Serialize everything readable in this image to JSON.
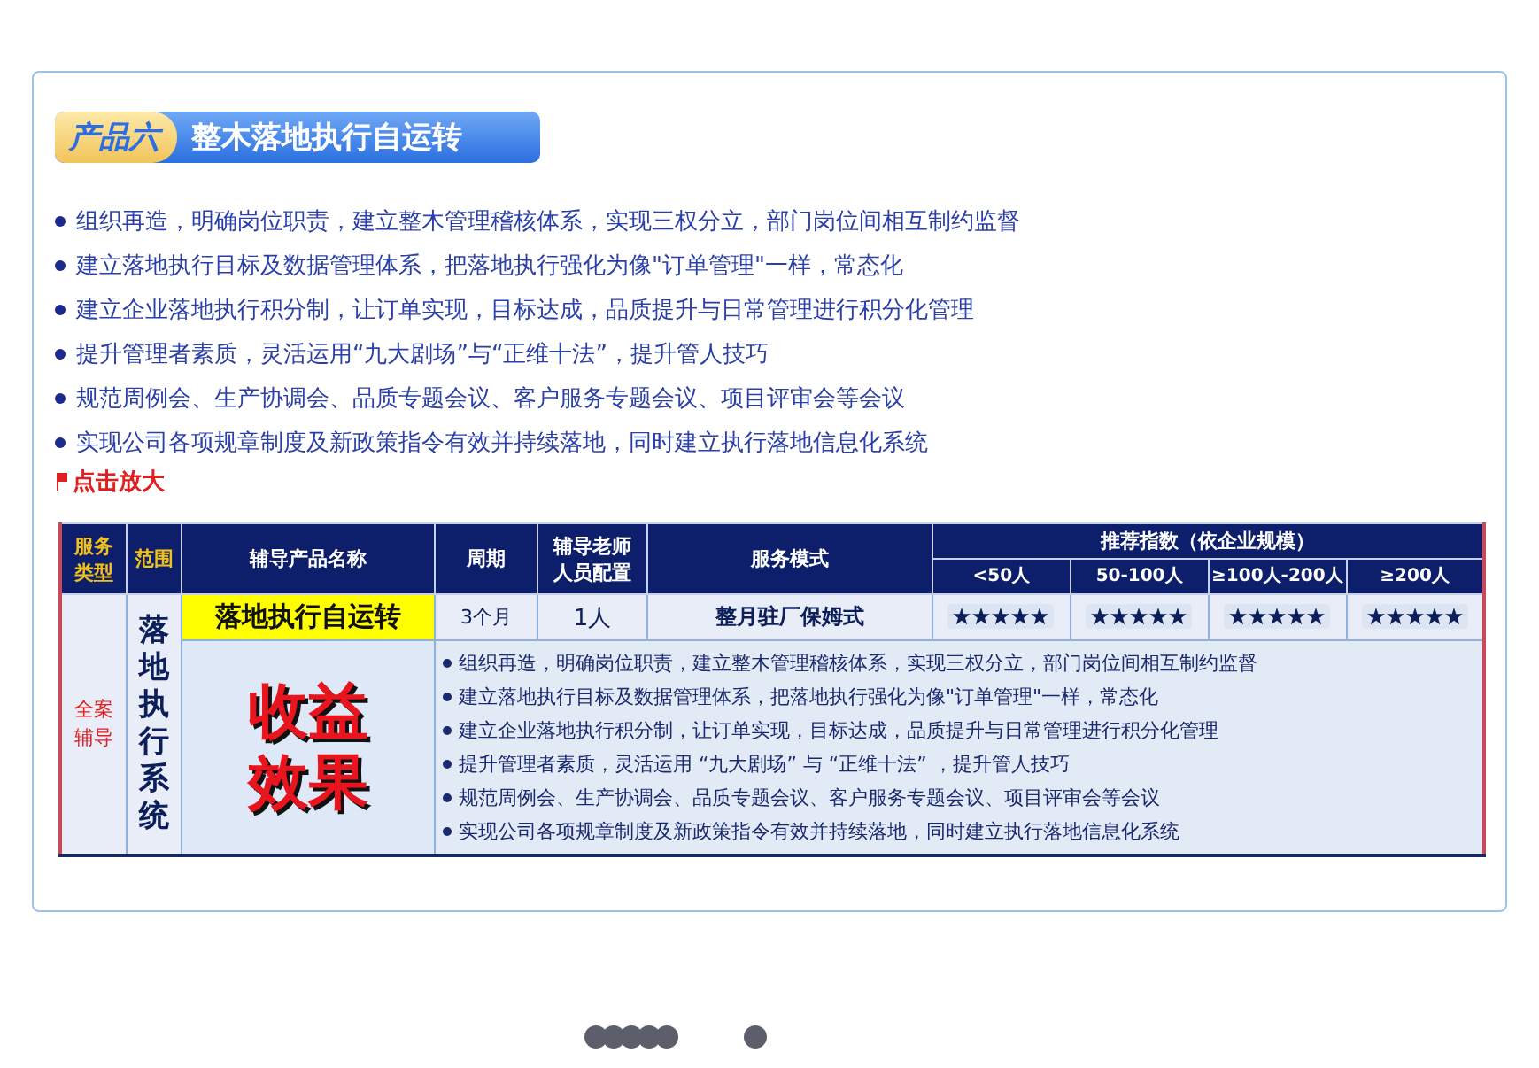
{
  "product": {
    "tag": "产品六",
    "title": "整木落地执行自运转"
  },
  "bullets": [
    "组织再造，明确岗位职责，建立整木管理稽核体系，实现三权分立，部门岗位间相互制约监督",
    "建立落地执行目标及数据管理体系，把落地执行强化为像\"订单管理\"一样，常态化",
    "建立企业落地执行积分制，让订单实现，目标达成，品质提升与日常管理进行积分化管理",
    "提升管理者素质，灵活运用“九大剧场”与“正维十法”，提升管人技巧",
    "规范周例会、生产协调会、品质专题会议、客户服务专题会议、项目评审会等会议",
    "实现公司各项规章制度及新政策指令有效并持续落地，同时建立执行落地信息化系统"
  ],
  "zoom_link": "点击放大",
  "table": {
    "columns": [
      "服务类型",
      "范围",
      "辅导产品名称",
      "周期",
      "辅导老师人员配置",
      "服务模式"
    ],
    "recommend_header": "推荐指数（依企业规模）",
    "size_columns": [
      "<50人",
      "50-100人",
      "≥100人-200人",
      "≥200人"
    ],
    "row": {
      "service_type": "全案辅导",
      "scope": "落地执行系统",
      "product_name": "落地执行自运转",
      "period": "3个月",
      "staff": "1人",
      "mode": "整月驻厂保姆式",
      "ratings": [
        {
          "stars": 5
        },
        {
          "stars": 5
        },
        {
          "stars": 5
        },
        {
          "stars": 5
        }
      ],
      "benefit_label": "收益效果",
      "benefits": [
        "组织再造，明确岗位职责，建立整木管理稽核体系，实现三权分立，部门岗位间相互制约监督",
        "建立落地执行目标及数据管理体系，把落地执行强化为像\"订单管理\"一样，常态化",
        "建立企业落地执行积分制，让订单实现，目标达成，品质提升与日常管理进行积分化管理",
        "提升管理者素质，灵活运用 “九大剧场” 与 “正维十法” ，提升管人技巧",
        "规范周例会、生产协调会、品质专题会议、客户服务专题会议、项目评审会等会议",
        "实现公司各项规章制度及新政策指令有效并持续落地，同时建立执行落地信息化系统"
      ]
    }
  }
}
